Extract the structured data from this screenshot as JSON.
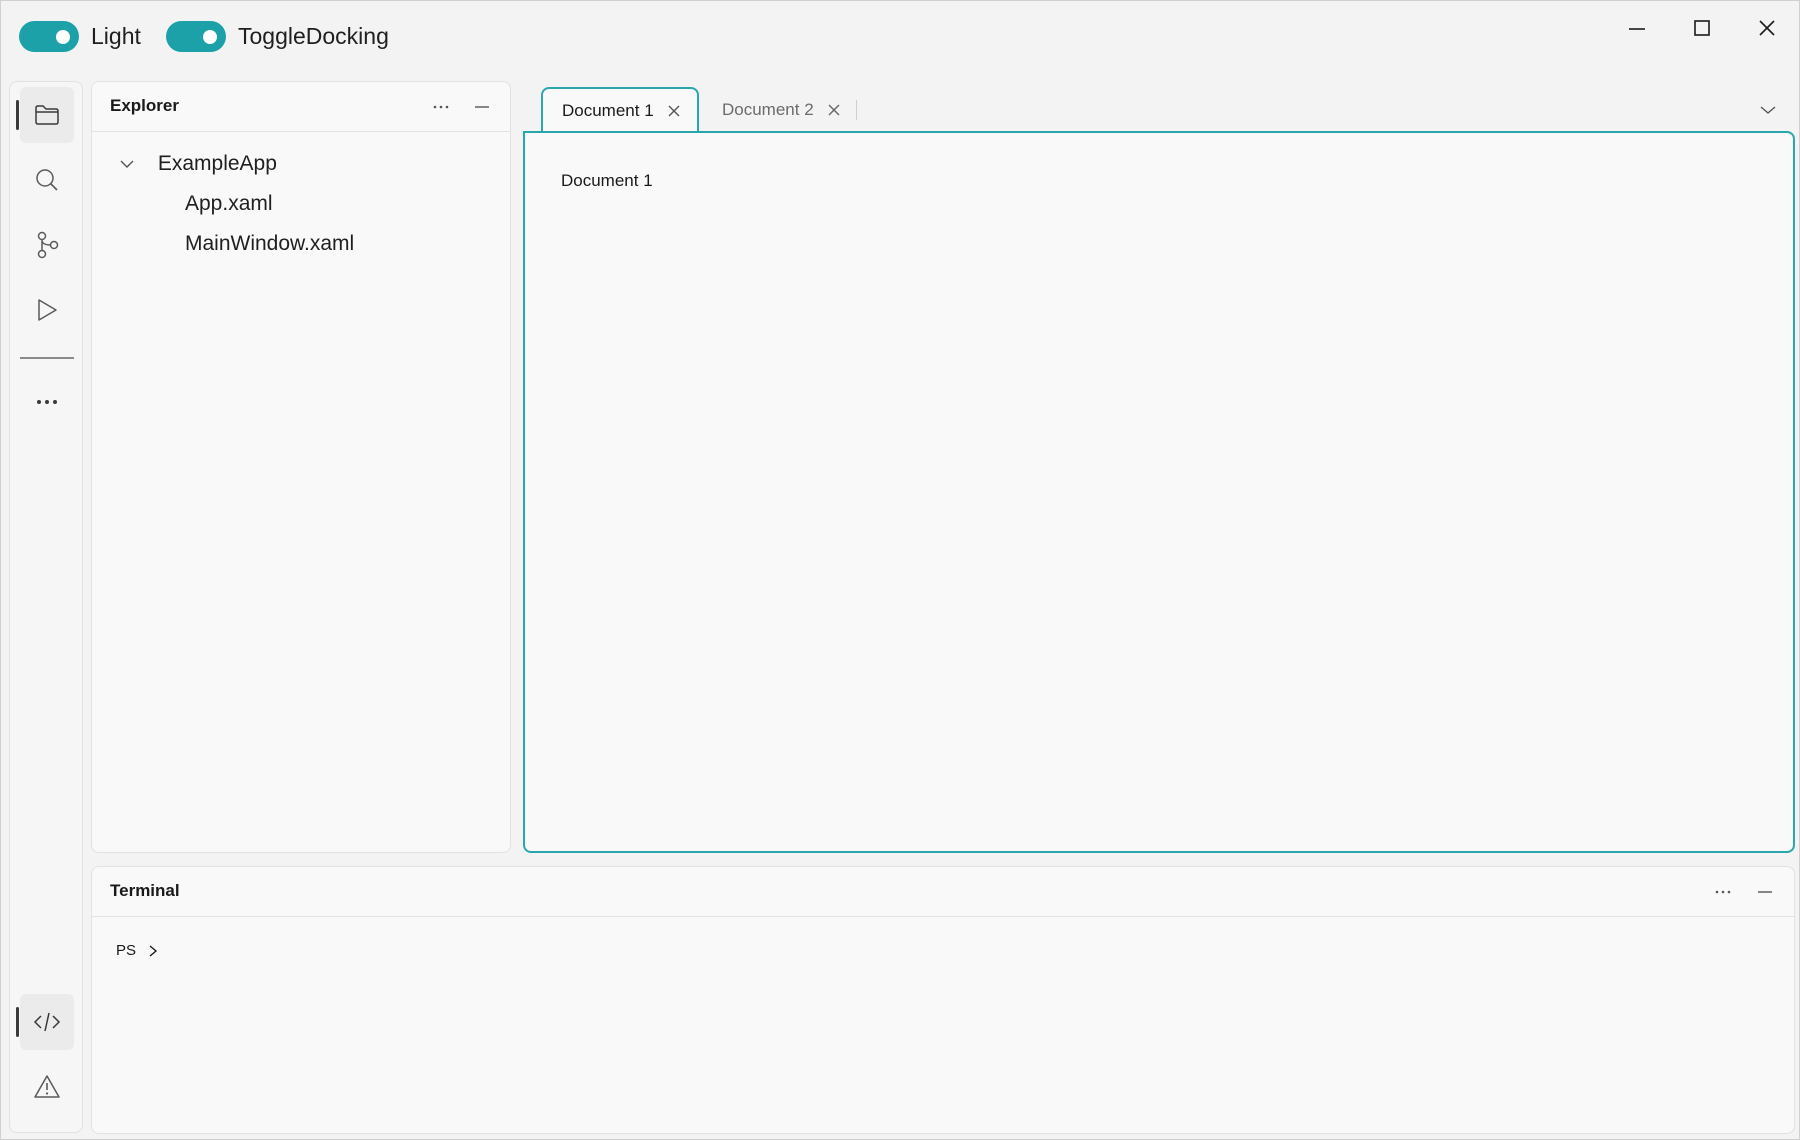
{
  "titlebar": {
    "toggles": [
      {
        "label": "Light",
        "on": true
      },
      {
        "label": "ToggleDocking",
        "on": true
      }
    ],
    "controls": [
      "minimize",
      "maximize",
      "close"
    ]
  },
  "activity_bar": {
    "items": [
      "folder-icon",
      "search-icon",
      "source-control-icon",
      "run-icon",
      "more-icon"
    ],
    "bottom_items": [
      "code-icon",
      "warning-icon"
    ]
  },
  "explorer": {
    "title": "Explorer",
    "tree": {
      "root": "ExampleApp",
      "expanded": true,
      "children": [
        "App.xaml",
        "MainWindow.xaml"
      ]
    }
  },
  "tabs": [
    {
      "label": "Document 1",
      "active": true
    },
    {
      "label": "Document 2",
      "active": false
    }
  ],
  "document": {
    "content": "Document 1"
  },
  "terminal": {
    "title": "Terminal",
    "prompt": "PS"
  },
  "colors": {
    "accent": "#1ba1a7",
    "tab_border": "#2aa7ad",
    "background": "#f3f3f3",
    "panel": "#f9f9f9"
  }
}
